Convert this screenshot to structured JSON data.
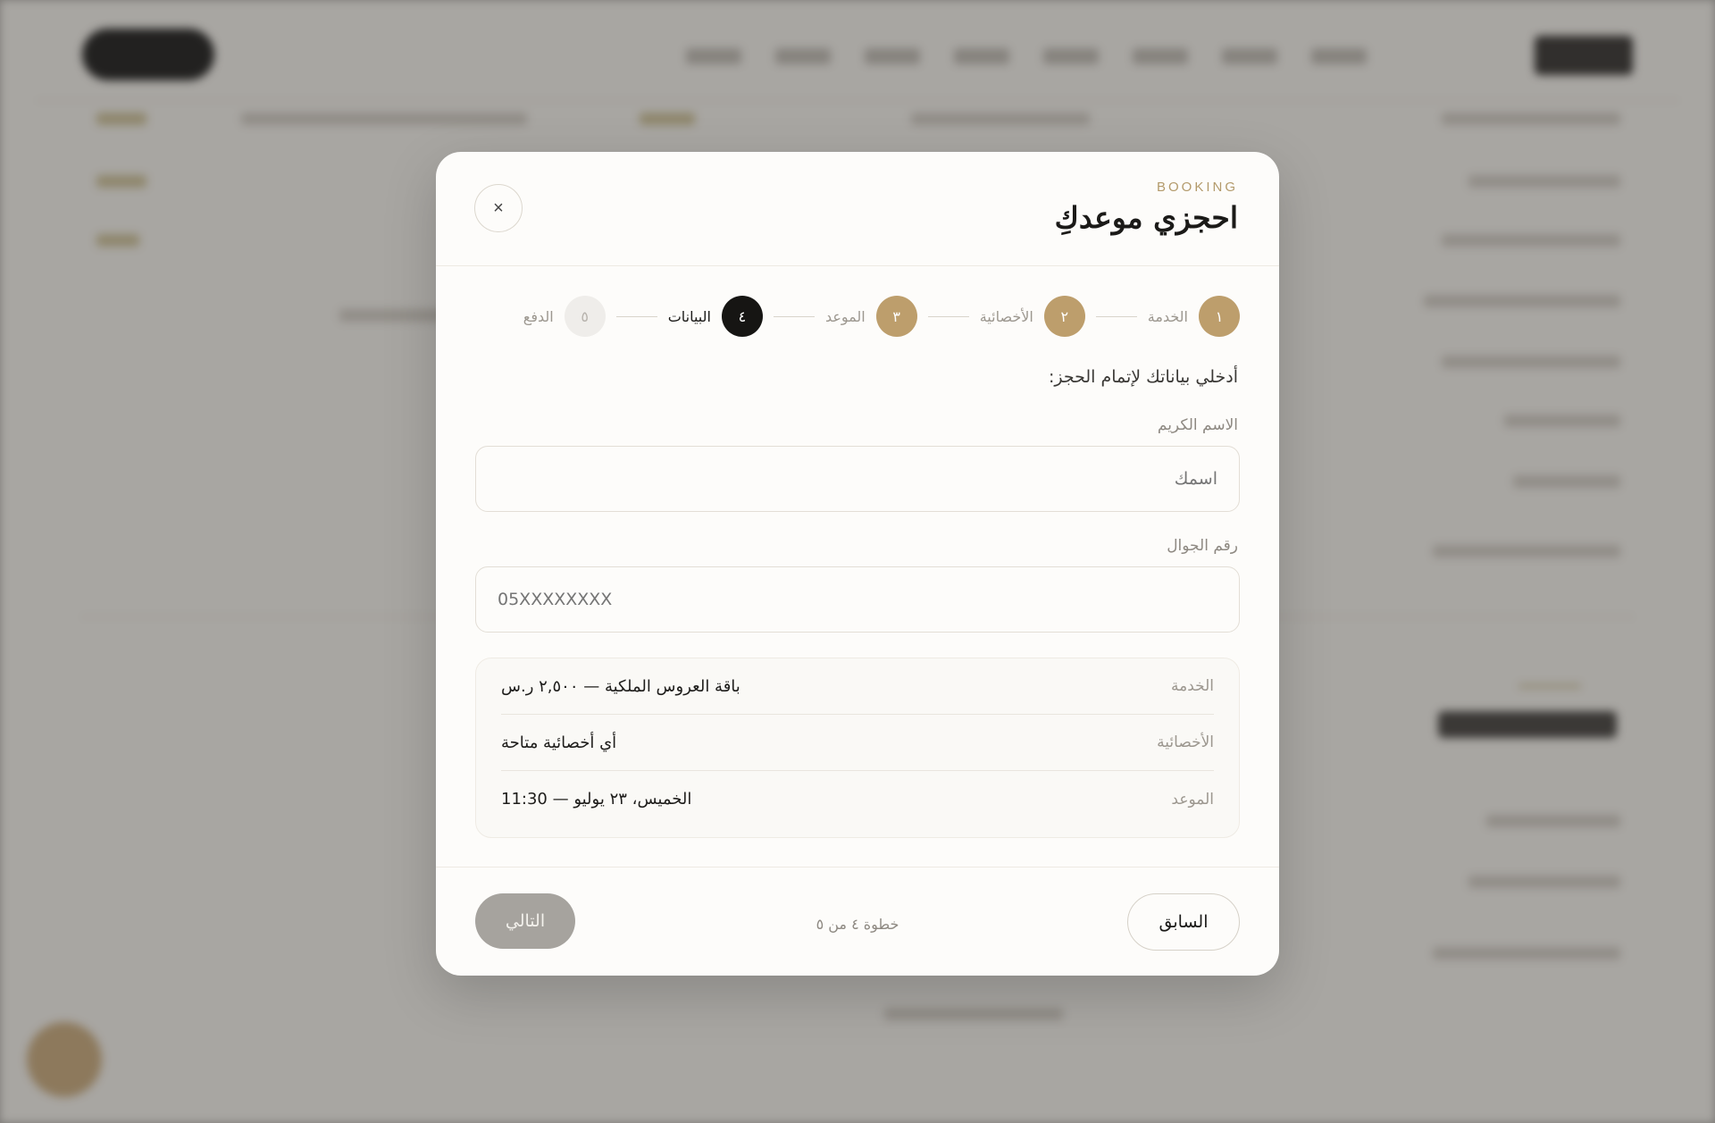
{
  "modal": {
    "overline": "BOOKING",
    "title": "احجزي موعدكِ",
    "close_glyph": "×",
    "intro": "أدخلي بياناتك لإتمام الحجز:"
  },
  "stepper": {
    "steps": [
      {
        "number": "١",
        "label": "الخدمة",
        "state": "done"
      },
      {
        "number": "٢",
        "label": "الأخصائية",
        "state": "done"
      },
      {
        "number": "٣",
        "label": "الموعد",
        "state": "done"
      },
      {
        "number": "٤",
        "label": "البيانات",
        "state": "active"
      },
      {
        "number": "٥",
        "label": "الدفع",
        "state": "pending"
      }
    ]
  },
  "form": {
    "name": {
      "label": "الاسم الكريم",
      "placeholder": "اسمك",
      "value": ""
    },
    "phone": {
      "label": "رقم الجوال",
      "placeholder": "05XXXXXXXX",
      "value": ""
    }
  },
  "summary": {
    "rows": [
      {
        "key": "الخدمة",
        "value": "باقة العروس الملكية — ٢,٥٠٠ ر.س"
      },
      {
        "key": "الأخصائية",
        "value": "أي أخصائية متاحة"
      },
      {
        "key": "الموعد",
        "value": "الخميس، ٢٣ يوليو — 11:30"
      }
    ]
  },
  "footer": {
    "prev_label": "السابق",
    "next_label": "التالي",
    "step_counter": "خطوة ٤ من ٥"
  },
  "colors": {
    "accent_gold": "#bd9e6c",
    "active_dark": "#161513",
    "disabled_button": "#a6a39e",
    "modal_bg": "#fdfcfa"
  },
  "icons": {
    "close": "close-icon"
  }
}
